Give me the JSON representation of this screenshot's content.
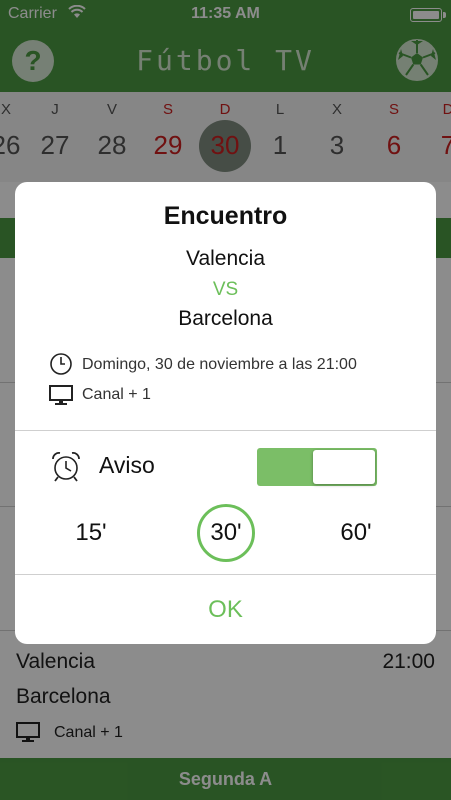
{
  "status_bar": {
    "carrier": "Carrier",
    "time": "11:35 AM"
  },
  "nav": {
    "title": "Fútbol TV",
    "help_label": "?"
  },
  "days": [
    {
      "weekday": "X",
      "day": "26",
      "weekend": false
    },
    {
      "weekday": "J",
      "day": "27",
      "weekend": false
    },
    {
      "weekday": "V",
      "day": "28",
      "weekend": false
    },
    {
      "weekday": "S",
      "day": "29",
      "weekend": true
    },
    {
      "weekday": "D",
      "day": "30",
      "weekend": true,
      "selected": true
    },
    {
      "weekday": "L",
      "day": "1",
      "weekend": false
    },
    {
      "weekday": "X",
      "day": "3",
      "weekend": false
    },
    {
      "weekday": "S",
      "day": "6",
      "weekend": true
    },
    {
      "weekday": "D",
      "day": "7",
      "weekend": true
    }
  ],
  "background_match": {
    "home": "Valencia",
    "away": "Barcelona",
    "time": "21:00",
    "channel": "Canal + 1"
  },
  "section_header": "Segunda A",
  "modal": {
    "title": "Encuentro",
    "home": "Valencia",
    "vs": "VS",
    "away": "Barcelona",
    "datetime": "Domingo, 30 de noviembre a las 21:00",
    "channel": "Canal + 1",
    "alarm_label": "Aviso",
    "alarm_enabled": true,
    "options": [
      "15'",
      "30'",
      "60'"
    ],
    "selected_option": "30'",
    "ok_label": "OK"
  },
  "colors": {
    "brand_green": "#4c9a42",
    "accent_green": "#6cbf5a",
    "weekend_red": "#cc2020"
  },
  "icons": {
    "help": "question-icon",
    "ball": "soccer-ball-icon",
    "clock": "clock-icon",
    "tv": "tv-icon",
    "alarm": "alarm-clock-icon",
    "wifi": "wifi-icon",
    "battery": "battery-icon"
  }
}
